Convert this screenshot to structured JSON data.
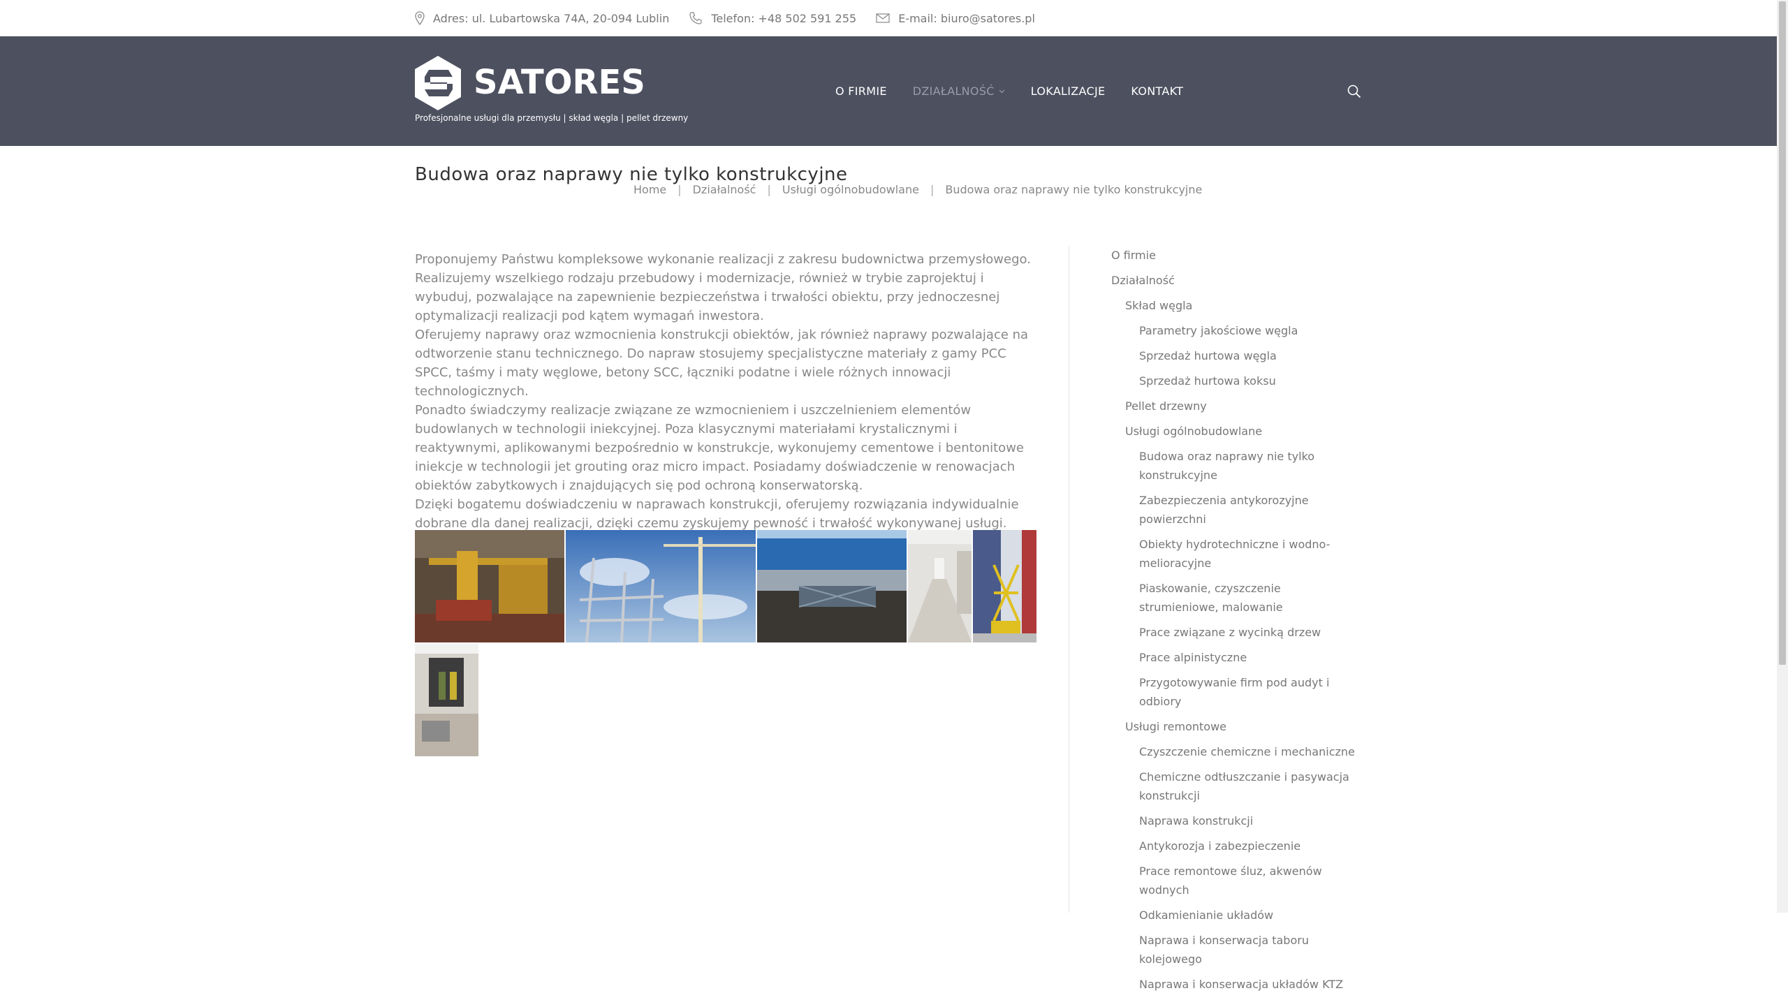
{
  "topbar": {
    "address": "Adres: ul. Lubartowska 74A, 20-094 Lublin",
    "phone": "Telefon: +48 502 591 255",
    "email": "E-mail: biuro@satores.pl"
  },
  "header": {
    "logo_text": "SATORES",
    "tagline": "Profesjonalne usługi dla przemysłu | skład węgla | pellet drzewny",
    "nav": [
      {
        "label": "O FIRMIE"
      },
      {
        "label": "DZIAŁALNOŚĆ"
      },
      {
        "label": "LOKALIZACJE"
      },
      {
        "label": "KONTAKT"
      }
    ],
    "colors": {
      "header_bg": "#4d505f",
      "active_nav": "#9a9cab"
    }
  },
  "page": {
    "title": "Budowa oraz naprawy nie tylko konstrukcyjne",
    "breadcrumb": [
      "Home",
      "Działalność",
      "Usługi ogólnobudowlane",
      "Budowa oraz naprawy nie tylko konstrukcyjne"
    ]
  },
  "content": {
    "paragraphs": [
      "Proponujemy Państwu kompleksowe wykonanie realizacji z zakresu budownictwa przemysłowego. Realizujemy wszelkiego rodzaju przebudowy i modernizacje, również w trybie zaprojektuj i wybuduj, pozwalające na zapewnienie bezpieczeństwa i trwałości obiektu, przy jednoczesnej optymalizacji realizacji pod kątem wymagań inwestora.",
      "Oferujemy naprawy oraz wzmocnienia konstrukcji obiektów, jak również naprawy pozwalające na odtworzenie stanu technicznego. Do napraw stosujemy specjalistyczne materiały z gamy PCC SPCC, taśmy i maty węglowe, betony SCC, łączniki podatne i wiele różnych innowacji technologicznych.",
      "Ponadto świadczymy realizacje związane ze wzmocnieniem i uszczelnieniem elementów budowlanych w technologii iniekcyjnej. Poza klasycznymi materiałami krystalicznymi i reaktywnymi, aplikowanymi bezpośrednio w konstrukcje, wykonujemy cementowe i bentonitowe iniekcje w technologii jet grouting oraz micro impact. Posiadamy doświadczenie w renowacjach obiektów zabytkowych i znajdujących się pod ochroną konserwatorską.",
      "Dzięki bogatemu doświadczeniu w naprawach konstrukcji, oferujemy rozwiązania indywidualnie dobrane dla danej realizacji, dzięki czemu zyskujemy pewność i trwałość wykonywanej usługi."
    ]
  },
  "sidebar": {
    "items": [
      {
        "label": "O firmie",
        "level": 1
      },
      {
        "label": "Działalność",
        "level": 1
      },
      {
        "label": "Skład węgla",
        "level": 2
      },
      {
        "label": "Parametry jakościowe węgla",
        "level": 3
      },
      {
        "label": "Sprzedaż hurtowa węgla",
        "level": 3
      },
      {
        "label": "Sprzedaż hurtowa koksu",
        "level": 3
      },
      {
        "label": "Pellet drzewny",
        "level": 2
      },
      {
        "label": "Usługi ogólnobudowlane",
        "level": 2
      },
      {
        "label": "Budowa oraz naprawy nie tylko konstrukcyjne",
        "level": 3
      },
      {
        "label": "Zabezpieczenia antykorozyjne powierzchni",
        "level": 3
      },
      {
        "label": "Obiekty hydrotechniczne i wodno-melioracyjne",
        "level": 3
      },
      {
        "label": "Piaskowanie, czyszczenie strumieniowe, malowanie",
        "level": 3
      },
      {
        "label": "Prace związane z wycinką drzew",
        "level": 3
      },
      {
        "label": "Prace alpinistyczne",
        "level": 3
      },
      {
        "label": "Przygotowywanie firm pod audyt i odbiory",
        "level": 3
      },
      {
        "label": "Usługi remontowe",
        "level": 2
      },
      {
        "label": "Czyszczenie chemiczne i mechaniczne",
        "level": 3
      },
      {
        "label": "Chemiczne odtłuszczanie i pasywacja konstrukcji",
        "level": 3
      },
      {
        "label": "Naprawa konstrukcji",
        "level": 3
      },
      {
        "label": "Antykorozja i zabezpieczenie",
        "level": 3
      },
      {
        "label": "Prace remontowe śluz, akwenów wodnych",
        "level": 3
      },
      {
        "label": "Odkamienianie układów",
        "level": 3
      },
      {
        "label": "Naprawa i konserwacja taboru kolejowego",
        "level": 3
      },
      {
        "label": "Naprawa i konserwacja układów KTZ",
        "level": 3
      }
    ]
  },
  "icons": {
    "address": "map-pin-icon",
    "phone": "phone-icon",
    "email": "envelope-icon",
    "search": "search-icon",
    "dropdown": "chevron-down-icon"
  }
}
